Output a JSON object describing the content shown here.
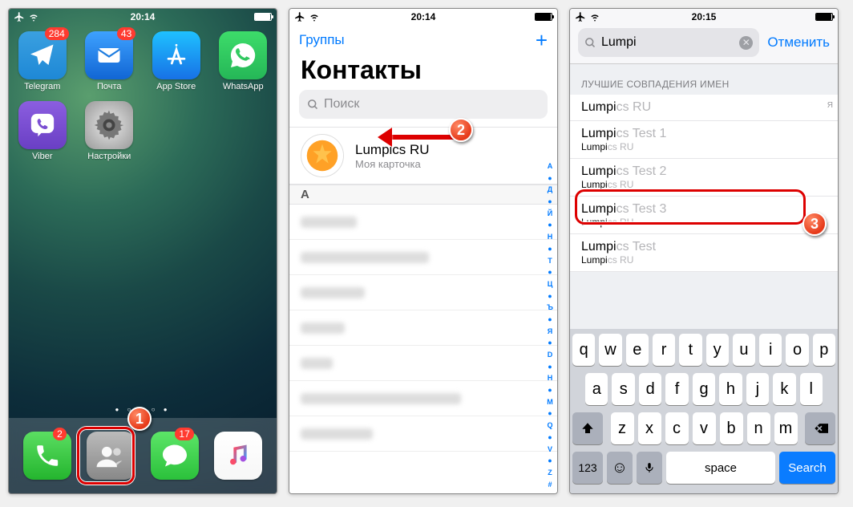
{
  "screen1": {
    "status": {
      "time": "20:14"
    },
    "apps": {
      "telegram": {
        "label": "Telegram",
        "badge": "284"
      },
      "mail": {
        "label": "Почта",
        "badge": "43"
      },
      "appstore": {
        "label": "App Store"
      },
      "whatsapp": {
        "label": "WhatsApp"
      },
      "viber": {
        "label": "Viber"
      },
      "settings": {
        "label": "Настройки"
      }
    },
    "dock": {
      "phone": {
        "badge": "2"
      },
      "contacts": {},
      "messages": {
        "badge": "17"
      },
      "music": {}
    },
    "callout": "1"
  },
  "screen2": {
    "status": {
      "time": "20:14"
    },
    "nav": {
      "groups": "Группы"
    },
    "title": "Контакты",
    "search_placeholder": "Поиск",
    "me": {
      "name": "Lumpics RU",
      "subtitle": "Моя карточка"
    },
    "section_letter": "A",
    "index_letters": [
      "А",
      "●",
      "Д",
      "●",
      "Й",
      "●",
      "Н",
      "●",
      "Т",
      "●",
      "Ц",
      "●",
      "Ъ",
      "●",
      "Я",
      "●",
      "D",
      "●",
      "H",
      "●",
      "M",
      "●",
      "Q",
      "●",
      "V",
      "●",
      "Z",
      "#"
    ],
    "callout": "2"
  },
  "screen3": {
    "status": {
      "time": "20:15"
    },
    "search_query": "Lumpi",
    "cancel": "Отменить",
    "section_title": "ЛУЧШИЕ СОВПАДЕНИЯ ИМЕН",
    "side_letter": "Я",
    "results": [
      {
        "name_match": "Lumpi",
        "name_rest": "cs RU",
        "sub_match": "",
        "sub_rest": ""
      },
      {
        "name_match": "Lumpi",
        "name_rest": "cs Test 1",
        "sub_match": "Lumpi",
        "sub_rest": "cs RU"
      },
      {
        "name_match": "Lumpi",
        "name_rest": "cs Test 2",
        "sub_match": "Lumpi",
        "sub_rest": "cs RU"
      },
      {
        "name_match": "Lumpi",
        "name_rest": "cs Test 3",
        "sub_match": "Lumpi",
        "sub_rest": "cs RU"
      },
      {
        "name_match": "Lumpi",
        "name_rest": "cs Test",
        "sub_match": "Lumpi",
        "sub_rest": "cs RU"
      }
    ],
    "keyboard": {
      "row1": [
        "q",
        "w",
        "e",
        "r",
        "t",
        "y",
        "u",
        "i",
        "o",
        "p"
      ],
      "row2": [
        "a",
        "s",
        "d",
        "f",
        "g",
        "h",
        "j",
        "k",
        "l"
      ],
      "row3": [
        "z",
        "x",
        "c",
        "v",
        "b",
        "n",
        "m"
      ],
      "num": "123",
      "space": "space",
      "search": "Search"
    },
    "callout": "3"
  }
}
